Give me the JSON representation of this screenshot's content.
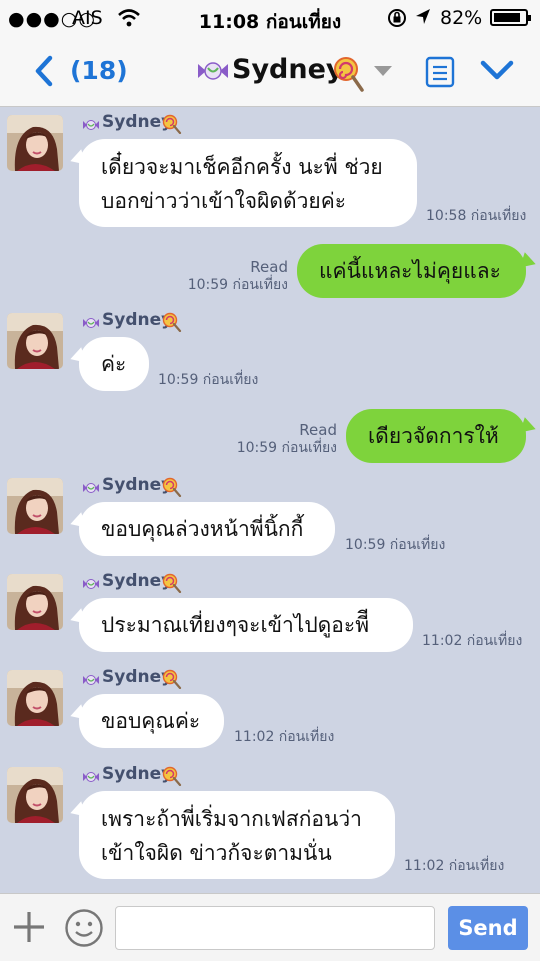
{
  "status_bar": {
    "signal": "●●●○○",
    "carrier": "AIS",
    "time": "11:08 ก่อนเที่ยง",
    "battery_percent": "82%",
    "battery_level": 0.82
  },
  "nav": {
    "back_count": "(18)",
    "title": "Sydney",
    "accent_color": "#1e74d6"
  },
  "messages": [
    {
      "type": "in",
      "name": "Sydney",
      "lines": [
        "เดี๋ยวจะมาเช็คอีกครั้ง นะพี่ ช่วย",
        "บอกข่าวว่าเข้าใจผิดด้วยค่ะ"
      ],
      "time": "10:58 ก่อนเที่ยง"
    },
    {
      "type": "out",
      "status": "Read",
      "text": "แค่นี้แหละไม่คุยและ",
      "time": "10:59 ก่อนเที่ยง"
    },
    {
      "type": "in",
      "name": "Sydney",
      "lines": [
        "ค่ะ"
      ],
      "time": "10:59 ก่อนเที่ยง"
    },
    {
      "type": "out",
      "status": "Read",
      "text": "เดียวจัดการให้",
      "time": "10:59 ก่อนเที่ยง"
    },
    {
      "type": "in",
      "name": "Sydney",
      "lines": [
        "ขอบคุณล่วงหน้าพี่นิ้กกี้"
      ],
      "time": "10:59 ก่อนเที่ยง"
    },
    {
      "type": "in",
      "name": "Sydney",
      "lines": [
        "ประมาณเที่ยงๆจะเข้าไปดูอะพีี"
      ],
      "time": "11:02 ก่อนเที่ยง"
    },
    {
      "type": "in",
      "name": "Sydney",
      "lines": [
        "ขอบคุณค่ะ"
      ],
      "time": "11:02 ก่อนเที่ยง"
    },
    {
      "type": "in",
      "name": "Sydney",
      "lines": [
        "เพราะถ้าพี่เริ่มจากเฟสก่อนว่า",
        "เข้าใจผิด ข่าวก้จะตามนั่น"
      ],
      "time": "11:02 ก่อนเที่ยง"
    }
  ],
  "input": {
    "placeholder": "",
    "send_label": "Send",
    "send_color": "#5b8fe6"
  },
  "colors": {
    "chat_background": "#ced4e3",
    "outgoing_bubble": "#7ed33c",
    "incoming_bubble": "#ffffff"
  }
}
